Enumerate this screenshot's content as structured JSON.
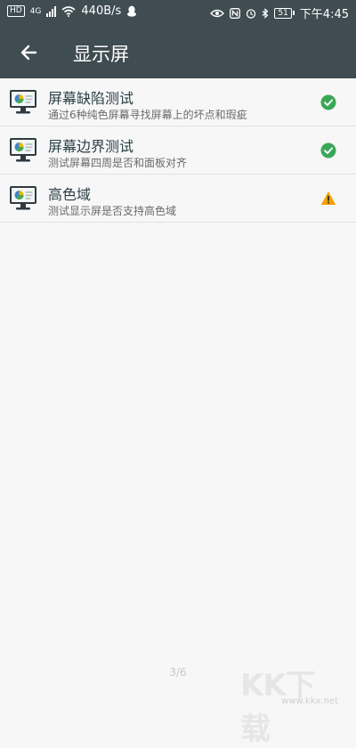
{
  "status": {
    "hd": "HD",
    "net": "4G",
    "speed": "440B/s",
    "battery": "51",
    "time": "下午4:45"
  },
  "header": {
    "back_icon": "arrow-left-icon",
    "title": "显示屏"
  },
  "items": [
    {
      "title": "屏幕缺陷测试",
      "subtitle": "通过6种纯色屏幕寻找屏幕上的坏点和瑕疵",
      "icon": "monitor-icon",
      "state": "success"
    },
    {
      "title": "屏幕边界测试",
      "subtitle": "测试屏幕四周是否和面板对齐",
      "icon": "monitor-icon",
      "state": "success"
    },
    {
      "title": "高色域",
      "subtitle": "测试显示屏是否支持高色域",
      "icon": "monitor-icon",
      "state": "warning"
    }
  ],
  "pager": "3/6",
  "watermark": {
    "main": "KK下载",
    "url": "www.kkx.net"
  },
  "colors": {
    "topbar": "#3f4c52",
    "success": "#3aa757",
    "warning": "#f2a100"
  }
}
